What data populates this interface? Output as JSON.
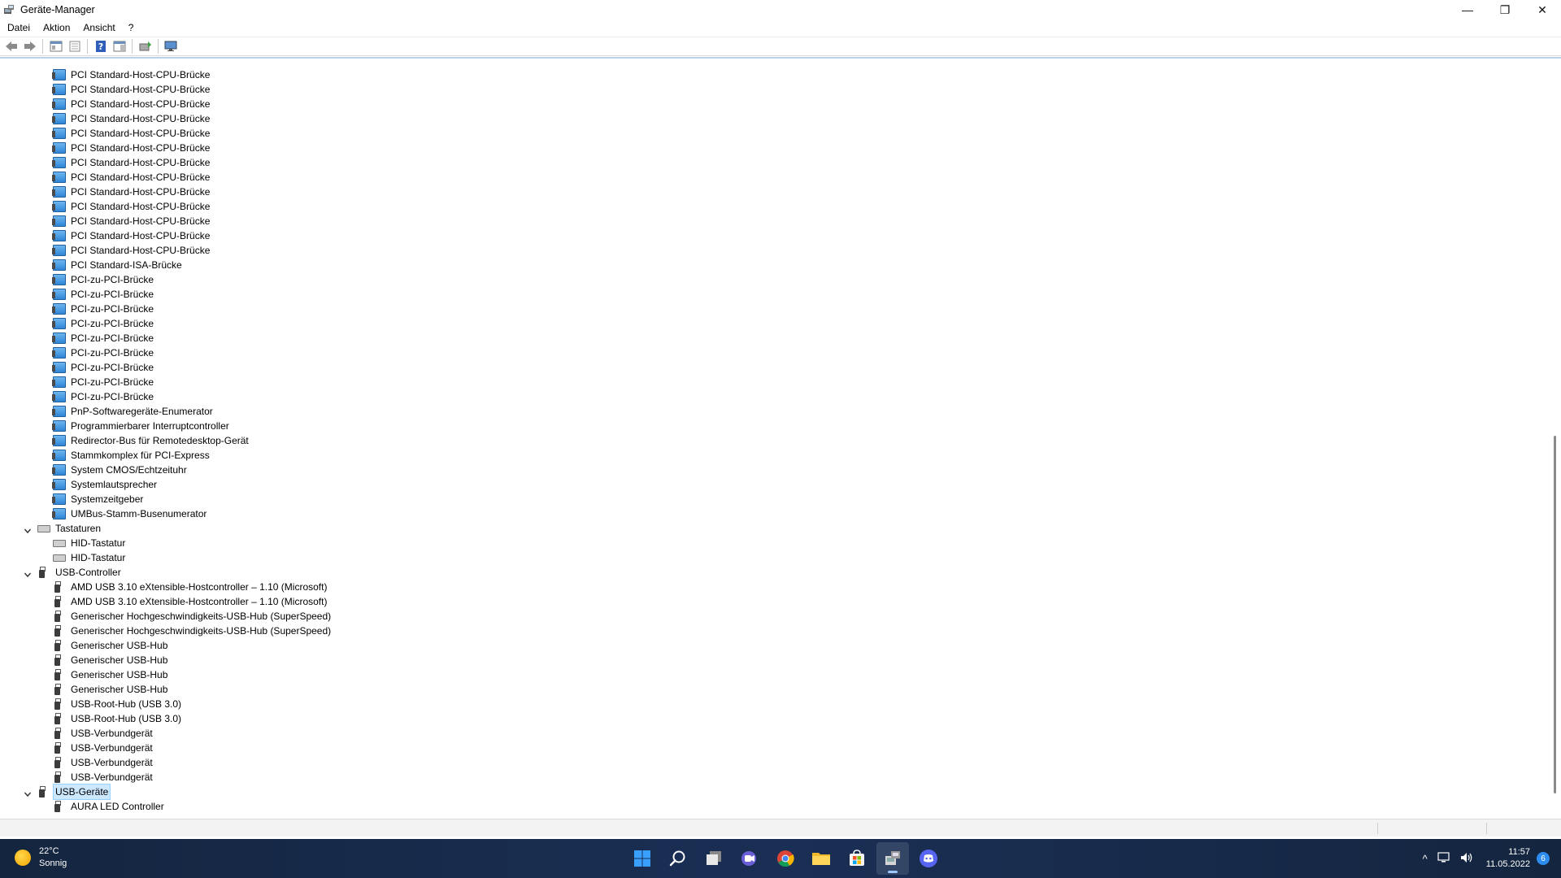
{
  "window": {
    "title": "Geräte-Manager",
    "controls": {
      "minimize": "—",
      "maximize": "❐",
      "close": "✕"
    }
  },
  "menu": [
    "Datei",
    "Aktion",
    "Ansicht",
    "?"
  ],
  "toolbar": {
    "buttons": [
      "back-icon",
      "forward-icon",
      "console-tree-icon",
      "properties-icon",
      "help-icon",
      "action-pane-icon",
      "update-driver-icon",
      "scan-hardware-icon"
    ]
  },
  "tree": [
    {
      "level": 2,
      "icon": "system",
      "label": "PCI Standard-Host-CPU-Brücke"
    },
    {
      "level": 2,
      "icon": "system",
      "label": "PCI Standard-Host-CPU-Brücke"
    },
    {
      "level": 2,
      "icon": "system",
      "label": "PCI Standard-Host-CPU-Brücke"
    },
    {
      "level": 2,
      "icon": "system",
      "label": "PCI Standard-Host-CPU-Brücke"
    },
    {
      "level": 2,
      "icon": "system",
      "label": "PCI Standard-Host-CPU-Brücke"
    },
    {
      "level": 2,
      "icon": "system",
      "label": "PCI Standard-Host-CPU-Brücke"
    },
    {
      "level": 2,
      "icon": "system",
      "label": "PCI Standard-Host-CPU-Brücke"
    },
    {
      "level": 2,
      "icon": "system",
      "label": "PCI Standard-Host-CPU-Brücke"
    },
    {
      "level": 2,
      "icon": "system",
      "label": "PCI Standard-Host-CPU-Brücke"
    },
    {
      "level": 2,
      "icon": "system",
      "label": "PCI Standard-Host-CPU-Brücke"
    },
    {
      "level": 2,
      "icon": "system",
      "label": "PCI Standard-Host-CPU-Brücke"
    },
    {
      "level": 2,
      "icon": "system",
      "label": "PCI Standard-Host-CPU-Brücke"
    },
    {
      "level": 2,
      "icon": "system",
      "label": "PCI Standard-Host-CPU-Brücke"
    },
    {
      "level": 2,
      "icon": "system",
      "label": "PCI Standard-ISA-Brücke"
    },
    {
      "level": 2,
      "icon": "system",
      "label": "PCI-zu-PCI-Brücke"
    },
    {
      "level": 2,
      "icon": "system",
      "label": "PCI-zu-PCI-Brücke"
    },
    {
      "level": 2,
      "icon": "system",
      "label": "PCI-zu-PCI-Brücke"
    },
    {
      "level": 2,
      "icon": "system",
      "label": "PCI-zu-PCI-Brücke"
    },
    {
      "level": 2,
      "icon": "system",
      "label": "PCI-zu-PCI-Brücke"
    },
    {
      "level": 2,
      "icon": "system",
      "label": "PCI-zu-PCI-Brücke"
    },
    {
      "level": 2,
      "icon": "system",
      "label": "PCI-zu-PCI-Brücke"
    },
    {
      "level": 2,
      "icon": "system",
      "label": "PCI-zu-PCI-Brücke"
    },
    {
      "level": 2,
      "icon": "system",
      "label": "PCI-zu-PCI-Brücke"
    },
    {
      "level": 2,
      "icon": "system",
      "label": "PnP-Softwaregeräte-Enumerator"
    },
    {
      "level": 2,
      "icon": "system",
      "label": "Programmierbarer Interruptcontroller"
    },
    {
      "level": 2,
      "icon": "system",
      "label": "Redirector-Bus für Remotedesktop-Gerät"
    },
    {
      "level": 2,
      "icon": "system",
      "label": "Stammkomplex für PCI-Express"
    },
    {
      "level": 2,
      "icon": "system",
      "label": "System CMOS/Echtzeituhr"
    },
    {
      "level": 2,
      "icon": "system",
      "label": "Systemlautsprecher"
    },
    {
      "level": 2,
      "icon": "system",
      "label": "Systemzeitgeber"
    },
    {
      "level": 2,
      "icon": "system",
      "label": "UMBus-Stamm-Busenumerator"
    },
    {
      "level": 1,
      "icon": "keyboard",
      "label": "Tastaturen",
      "expanded": true
    },
    {
      "level": 2,
      "icon": "keyboard",
      "label": "HID-Tastatur"
    },
    {
      "level": 2,
      "icon": "keyboard",
      "label": "HID-Tastatur"
    },
    {
      "level": 1,
      "icon": "usb",
      "label": "USB-Controller",
      "expanded": true
    },
    {
      "level": 2,
      "icon": "usb",
      "label": "AMD USB 3.10 eXtensible-Hostcontroller – 1.10 (Microsoft)"
    },
    {
      "level": 2,
      "icon": "usb",
      "label": "AMD USB 3.10 eXtensible-Hostcontroller – 1.10 (Microsoft)"
    },
    {
      "level": 2,
      "icon": "usb",
      "label": "Generischer Hochgeschwindigkeits-USB-Hub (SuperSpeed)"
    },
    {
      "level": 2,
      "icon": "usb",
      "label": "Generischer Hochgeschwindigkeits-USB-Hub (SuperSpeed)"
    },
    {
      "level": 2,
      "icon": "usb",
      "label": "Generischer USB-Hub"
    },
    {
      "level": 2,
      "icon": "usb",
      "label": "Generischer USB-Hub"
    },
    {
      "level": 2,
      "icon": "usb",
      "label": "Generischer USB-Hub"
    },
    {
      "level": 2,
      "icon": "usb",
      "label": "Generischer USB-Hub"
    },
    {
      "level": 2,
      "icon": "usb",
      "label": "USB-Root-Hub (USB 3.0)"
    },
    {
      "level": 2,
      "icon": "usb",
      "label": "USB-Root-Hub (USB 3.0)"
    },
    {
      "level": 2,
      "icon": "usb",
      "label": "USB-Verbundgerät"
    },
    {
      "level": 2,
      "icon": "usb",
      "label": "USB-Verbundgerät"
    },
    {
      "level": 2,
      "icon": "usb",
      "label": "USB-Verbundgerät"
    },
    {
      "level": 2,
      "icon": "usb",
      "label": "USB-Verbundgerät"
    },
    {
      "level": 1,
      "icon": "usb",
      "label": "USB-Geräte",
      "expanded": true,
      "selected": true
    },
    {
      "level": 2,
      "icon": "usb",
      "label": "AURA LED Controller"
    }
  ],
  "taskbar": {
    "weather": {
      "temp": "22°C",
      "condition": "Sonnig"
    },
    "apps": [
      "start-icon",
      "search-icon",
      "task-view-icon",
      "chat-icon",
      "chrome-icon",
      "file-explorer-icon",
      "store-icon",
      "device-manager-icon",
      "discord-icon"
    ],
    "active_app": "device-manager-icon",
    "tray": {
      "chevron": "^",
      "time": "11:57",
      "date": "11.05.2022",
      "notifications": "6"
    }
  },
  "colors": {
    "selection": "#cce8ff",
    "taskbar": "#1a2f55",
    "accent": "#2d8cf0"
  }
}
